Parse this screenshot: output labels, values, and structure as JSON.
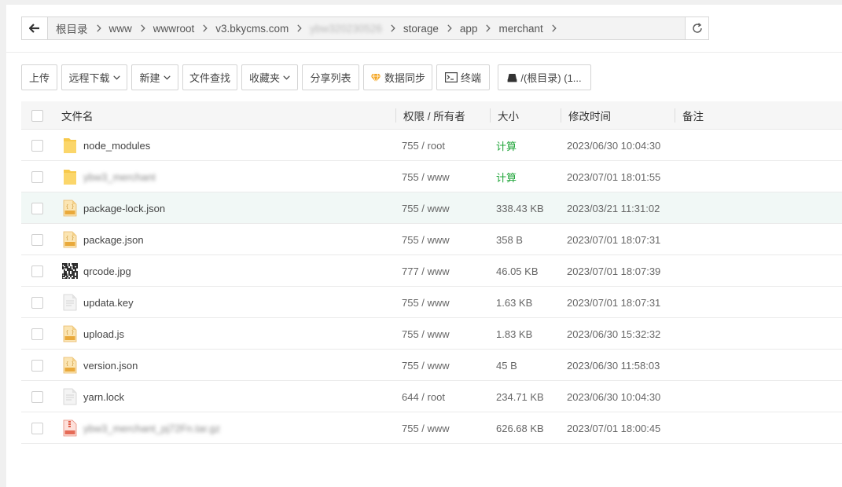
{
  "path": {
    "crumbs": [
      {
        "label": "根目录",
        "blur": false
      },
      {
        "label": "www",
        "blur": false
      },
      {
        "label": "wwwroot",
        "blur": false
      },
      {
        "label": "v3.bkycms.com",
        "blur": false
      },
      {
        "label": "ybw320230526",
        "blur": true
      },
      {
        "label": "storage",
        "blur": false
      },
      {
        "label": "app",
        "blur": false
      },
      {
        "label": "merchant",
        "blur": false
      }
    ]
  },
  "toolbar": {
    "upload": "上传",
    "remote_download": "远程下载",
    "new": "新建",
    "file_search": "文件查找",
    "favorites": "收藏夹",
    "share_list": "分享列表",
    "data_sync": "数据同步",
    "terminal": "终端",
    "disk": "/(根目录) (1..."
  },
  "table": {
    "headers": {
      "name": "文件名",
      "permission": "权限 / 所有者",
      "size": "大小",
      "mtime": "修改时间",
      "remark": "备注"
    },
    "rows": [
      {
        "name": "node_modules",
        "perm": "755 / root",
        "size": "计算",
        "time": "2023/06/30 10:04:30",
        "icon": "folder-icon",
        "calc": true,
        "blur": false
      },
      {
        "name": "ybw3_merchant",
        "perm": "755 / www",
        "size": "计算",
        "time": "2023/07/01 18:01:55",
        "icon": "folder-icon",
        "calc": true,
        "blur": true
      },
      {
        "name": "package-lock.json",
        "perm": "755 / www",
        "size": "338.43 KB",
        "time": "2023/03/21 11:31:02",
        "icon": "json-file-icon",
        "calc": false,
        "blur": false,
        "hover": true
      },
      {
        "name": "package.json",
        "perm": "755 / www",
        "size": "358 B",
        "time": "2023/07/01 18:07:31",
        "icon": "json-file-icon",
        "calc": false,
        "blur": false
      },
      {
        "name": "qrcode.jpg",
        "perm": "777 / www",
        "size": "46.05 KB",
        "time": "2023/07/01 18:07:39",
        "icon": "qrcode-image-icon",
        "calc": false,
        "blur": false
      },
      {
        "name": "updata.key",
        "perm": "755 / www",
        "size": "1.63 KB",
        "time": "2023/07/01 18:07:31",
        "icon": "text-file-icon",
        "calc": false,
        "blur": false
      },
      {
        "name": "upload.js",
        "perm": "755 / www",
        "size": "1.83 KB",
        "time": "2023/06/30 15:32:32",
        "icon": "js-file-icon",
        "calc": false,
        "blur": false
      },
      {
        "name": "version.json",
        "perm": "755 / www",
        "size": "45 B",
        "time": "2023/06/30 11:58:03",
        "icon": "json-file-icon",
        "calc": false,
        "blur": false
      },
      {
        "name": "yarn.lock",
        "perm": "644 / root",
        "size": "234.71 KB",
        "time": "2023/06/30 10:04:30",
        "icon": "text-file-icon",
        "calc": false,
        "blur": false
      },
      {
        "name": "ybw3_merchant_pj72Fn.tar.gz",
        "perm": "755 / www",
        "size": "626.68 KB",
        "time": "2023/07/01 18:00:45",
        "icon": "archive-file-icon",
        "calc": false,
        "blur": true
      }
    ]
  },
  "colors": {
    "accent_green": "#20a53a",
    "folder_yellow": "#f7c94b",
    "hover_row": "#f1f8f6",
    "sync_icon": "#f5a623"
  }
}
